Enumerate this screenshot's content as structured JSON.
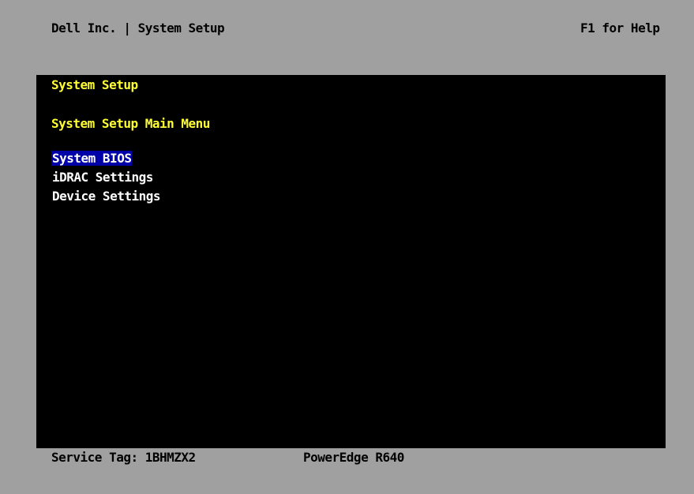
{
  "header": {
    "title": "Dell Inc. | System Setup",
    "help_hint": "F1 for Help"
  },
  "panel": {
    "title": "System Setup",
    "menu_heading": "System Setup Main Menu",
    "items": [
      {
        "label": "System BIOS",
        "selected": true
      },
      {
        "label": "iDRAC Settings",
        "selected": false
      },
      {
        "label": "Device Settings",
        "selected": false
      }
    ]
  },
  "footer": {
    "service_tag": "Service Tag: 1BHMZX2",
    "model": "PowerEdge R640"
  },
  "colors": {
    "background": "#a0a0a0",
    "panel": "#000000",
    "heading_text": "#ffff33",
    "menu_text": "#ffffff",
    "selection": "#0000a8"
  }
}
